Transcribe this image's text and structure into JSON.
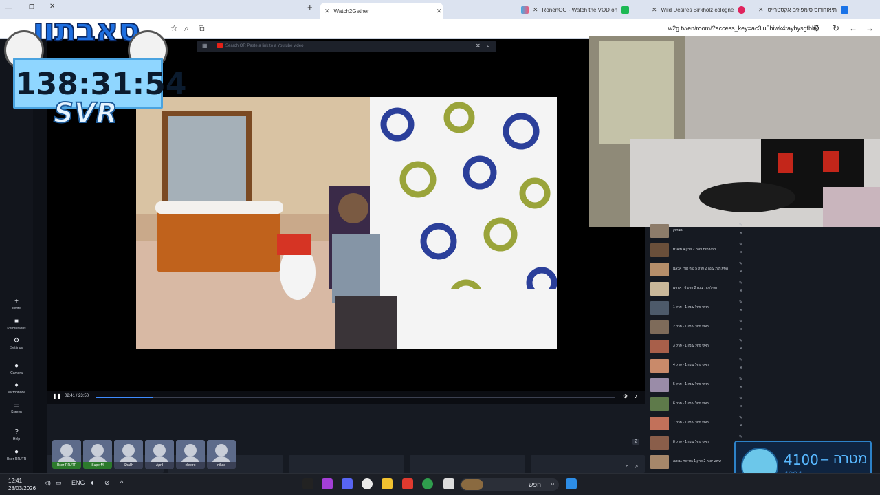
{
  "browser": {
    "tabs": [
      {
        "label": "Watch2Gether",
        "active": true
      },
      {
        "label": "RonenGG - Watch the VOD on",
        "active": false
      },
      {
        "label": "Wild Desires Birkholz cologne",
        "active": false
      },
      {
        "label": "תיאודורוס סימפוזים אקסטרייט",
        "active": false
      }
    ],
    "url": "w2g.tv/en/room/?access_key=ac3iu5hiwk4tayhysgfbla"
  },
  "overlay": {
    "logo_text": "סאבתון",
    "timer": "138:31:54",
    "timer_label": "SVR",
    "goal_value": "4100",
    "goal_dash": "–",
    "goal_label": "מטרה",
    "goal_current": "4004"
  },
  "sidebar": {
    "items": [
      {
        "label": "Invite",
        "icon": "person-plus-icon"
      },
      {
        "label": "Permissions",
        "icon": "lock-icon"
      },
      {
        "label": "Settings",
        "icon": "gear-icon"
      },
      {
        "label": "Camera",
        "icon": "camera-icon"
      },
      {
        "label": "Microphone",
        "icon": "microphone-icon"
      },
      {
        "label": "Screen",
        "icon": "screen-icon"
      },
      {
        "label": "Help",
        "icon": "help-icon"
      },
      {
        "label": "User-RRJTR",
        "icon": "user-icon"
      }
    ]
  },
  "player": {
    "search_placeholder": "Search OR Paste a link to a Youtube video",
    "time": "02:41 / 23:50",
    "progress": 0.11
  },
  "users": [
    {
      "name": "User-RRJTR",
      "green": true
    },
    {
      "name": "SuperM",
      "green": true
    },
    {
      "name": "Shalih",
      "green": false
    },
    {
      "name": "April",
      "green": false
    },
    {
      "name": "electro",
      "green": false
    },
    {
      "name": "nikas",
      "green": false
    }
  ],
  "user_count": "2",
  "playlist": [
    {
      "title": "מצחוק"
    },
    {
      "title": "הפיג'מות עונה 2 פרק 4 סיאנס"
    },
    {
      "title": "הפיג'מות עונה 2 פרק 5 קוף אורי אלאמה"
    },
    {
      "title": "הפיג'מות עונה 2 פרק 6 ראיתים"
    },
    {
      "title": "ראש גדול עונה 1 - פרק 1"
    },
    {
      "title": "ראש גדול עונה 1 - פרק 2"
    },
    {
      "title": "ראש גדול עונה 1 - פרק 3"
    },
    {
      "title": "ראש גדול עונה 1 - פרק 4"
    },
    {
      "title": "ראש גדול עונה 1 - פרק 5"
    },
    {
      "title": "ראש גדול עונה 1 - פרק 6"
    },
    {
      "title": "ראש גדול עונה 1 - פרק 7"
    },
    {
      "title": "ראש גדול עונה 1 - פרק 8"
    },
    {
      "title": "שמש עונה 2 פרק 1 באיכות גבוהה"
    }
  ],
  "taskbar": {
    "time": "12:41",
    "date": "28/03/2026",
    "lang": "ENG",
    "search": "חפש"
  }
}
